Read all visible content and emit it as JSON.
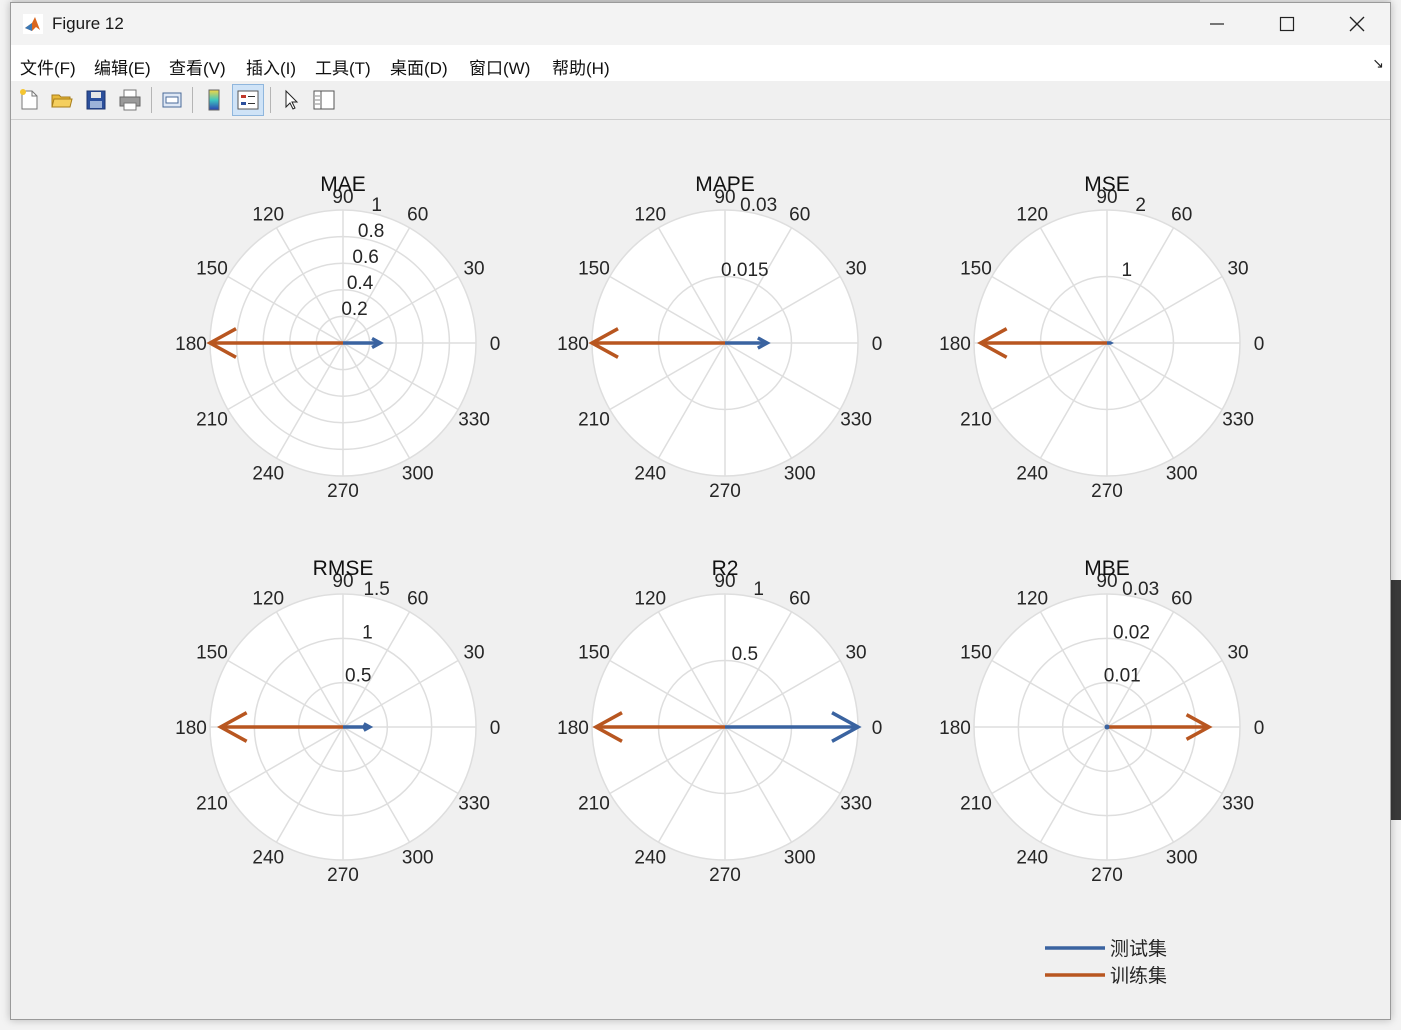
{
  "window": {
    "title": "Figure 12"
  },
  "menu": [
    "文件(F)",
    "编辑(E)",
    "查看(V)",
    "插入(I)",
    "工具(T)",
    "桌面(D)",
    "窗口(W)",
    "帮助(H)"
  ],
  "toolbar": [
    "new-figure",
    "open-file",
    "save",
    "print",
    "link-plot",
    "insert-colorbar",
    "insert-legend",
    "edit-plot",
    "property-inspector"
  ],
  "colors": {
    "test": "#3a63a0",
    "train": "#b85620",
    "grid": "#dedede"
  },
  "legend": {
    "entries": [
      "测试集",
      "训练集"
    ],
    "placement": "bottom-right"
  },
  "chart_data": [
    {
      "type": "compass",
      "title": "MAE",
      "angle_ticks": [
        "0",
        "30",
        "60",
        "90",
        "120",
        "150",
        "180",
        "210",
        "240",
        "270",
        "300",
        "330"
      ],
      "radial_ticks": [
        "0.2",
        "0.4",
        "0.6",
        "0.8",
        "1"
      ],
      "rmax": 1,
      "series": [
        {
          "name": "测试集",
          "angle_deg": 0,
          "magnitude": 0.28
        },
        {
          "name": "训练集",
          "angle_deg": 180,
          "magnitude": 1.0
        }
      ]
    },
    {
      "type": "compass",
      "title": "MAPE",
      "angle_ticks": [
        "0",
        "30",
        "60",
        "90",
        "120",
        "150",
        "180",
        "210",
        "240",
        "270",
        "300",
        "330"
      ],
      "radial_ticks": [
        "0.015",
        "0.03"
      ],
      "rmax": 0.03,
      "series": [
        {
          "name": "测试集",
          "angle_deg": 0,
          "magnitude": 0.0095
        },
        {
          "name": "训练集",
          "angle_deg": 180,
          "magnitude": 0.03
        }
      ]
    },
    {
      "type": "compass",
      "title": "MSE",
      "angle_ticks": [
        "0",
        "30",
        "60",
        "90",
        "120",
        "150",
        "180",
        "210",
        "240",
        "270",
        "300",
        "330"
      ],
      "radial_ticks": [
        "1",
        "2"
      ],
      "rmax": 2,
      "series": [
        {
          "name": "测试集",
          "angle_deg": 0,
          "magnitude": 0.05
        },
        {
          "name": "训练集",
          "angle_deg": 180,
          "magnitude": 1.9
        }
      ]
    },
    {
      "type": "compass",
      "title": "RMSE",
      "angle_ticks": [
        "0",
        "30",
        "60",
        "90",
        "120",
        "150",
        "180",
        "210",
        "240",
        "270",
        "300",
        "330"
      ],
      "radial_ticks": [
        "0.5",
        "1",
        "1.5"
      ],
      "rmax": 1.5,
      "series": [
        {
          "name": "测试集",
          "angle_deg": 0,
          "magnitude": 0.3
        },
        {
          "name": "训练集",
          "angle_deg": 180,
          "magnitude": 1.38
        }
      ]
    },
    {
      "type": "compass",
      "title": "R2",
      "angle_ticks": [
        "0",
        "30",
        "60",
        "90",
        "120",
        "150",
        "180",
        "210",
        "240",
        "270",
        "300",
        "330"
      ],
      "radial_ticks": [
        "0.5",
        "1"
      ],
      "rmax": 1,
      "series": [
        {
          "name": "测试集",
          "angle_deg": 0,
          "magnitude": 1.0
        },
        {
          "name": "训练集",
          "angle_deg": 180,
          "magnitude": 0.97
        }
      ]
    },
    {
      "type": "compass",
      "title": "MBE",
      "angle_ticks": [
        "0",
        "30",
        "60",
        "90",
        "120",
        "150",
        "180",
        "210",
        "240",
        "270",
        "300",
        "330"
      ],
      "radial_ticks": [
        "0.01",
        "0.02",
        "0.03"
      ],
      "rmax": 0.03,
      "series": [
        {
          "name": "测试集",
          "angle_deg": 0,
          "magnitude": 0.0
        },
        {
          "name": "训练集",
          "angle_deg": 0,
          "magnitude": 0.023
        }
      ]
    }
  ]
}
